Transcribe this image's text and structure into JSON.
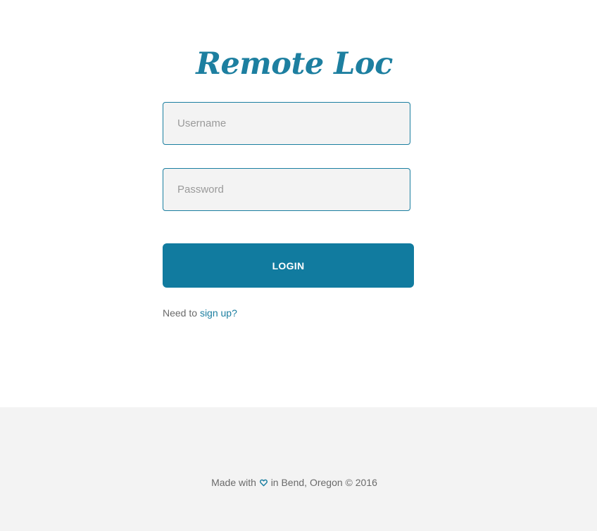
{
  "app": {
    "title": "Remote Loc"
  },
  "login_form": {
    "username_placeholder": "Username",
    "username_value": "",
    "password_placeholder": "Password",
    "password_value": "",
    "login_label": "LOGIN",
    "signup_prefix": "Need to ",
    "signup_link": "sign up?"
  },
  "footer": {
    "made_with": "Made with",
    "icon": "heart-icon",
    "location_text": "in Bend, Oregon © 2016"
  },
  "colors": {
    "brand": "#1a7ea0",
    "button": "#117b9f",
    "footer_bg": "#f3f3f3",
    "input_bg": "#f3f3f3"
  }
}
